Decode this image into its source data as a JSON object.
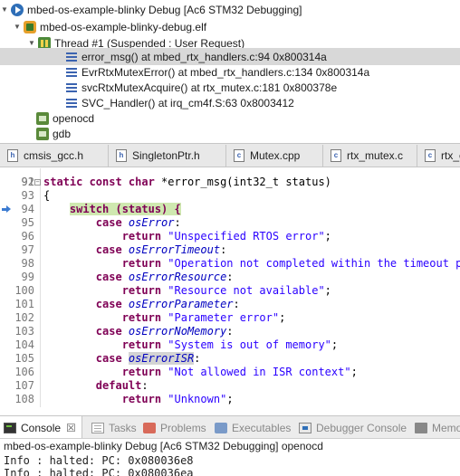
{
  "debug_tree": {
    "launch": "mbed-os-example-blinky Debug [Ac6 STM32 Debugging]",
    "elf": "mbed-os-example-blinky-debug.elf",
    "thread": "Thread #1 (Suspended : User Request)",
    "frames": [
      "error_msg() at mbed_rtx_handlers.c:94 0x800314a",
      "EvrRtxMutexError() at mbed_rtx_handlers.c:134 0x800314a",
      "svcRtxMutexAcquire() at rtx_mutex.c:181 0x800378e",
      "SVC_Handler() at irq_cm4f.S:63 0x8003412"
    ],
    "processes": [
      "openocd",
      "gdb"
    ]
  },
  "editor_tabs": [
    {
      "icon": "h",
      "label": "cmsis_gcc.h"
    },
    {
      "icon": "h",
      "label": "SingletonPtr.h"
    },
    {
      "icon": "c",
      "label": "Mutex.cpp"
    },
    {
      "icon": "c",
      "label": "rtx_mutex.c"
    },
    {
      "icon": "c",
      "label": "rtx_co"
    }
  ],
  "code": {
    "partial_line_number": "91",
    "lines": [
      {
        "n": "92",
        "parts": [
          [
            "kw",
            "static const char "
          ],
          [
            "",
            "*error_msg(int32_t status)"
          ]
        ]
      },
      {
        "n": "93",
        "parts": [
          [
            "",
            "{"
          ]
        ]
      },
      {
        "n": "94",
        "parts": [
          [
            "",
            "    "
          ],
          [
            "kw-green",
            "switch (status) {"
          ]
        ]
      },
      {
        "n": "95",
        "parts": [
          [
            "",
            "        "
          ],
          [
            "kw",
            "case "
          ],
          [
            "en",
            "osError"
          ],
          [
            "",
            ":"
          ]
        ]
      },
      {
        "n": "96",
        "parts": [
          [
            "",
            "            "
          ],
          [
            "kw",
            "return "
          ],
          [
            "str",
            "\"Unspecified RTOS error\""
          ],
          [
            "",
            ";"
          ]
        ]
      },
      {
        "n": "97",
        "parts": [
          [
            "",
            "        "
          ],
          [
            "kw",
            "case "
          ],
          [
            "en",
            "osErrorTimeout"
          ],
          [
            "",
            ":"
          ]
        ]
      },
      {
        "n": "98",
        "parts": [
          [
            "",
            "            "
          ],
          [
            "kw",
            "return "
          ],
          [
            "str",
            "\"Operation not completed within the timeout per"
          ]
        ]
      },
      {
        "n": "99",
        "parts": [
          [
            "",
            "        "
          ],
          [
            "kw",
            "case "
          ],
          [
            "en",
            "osErrorResource"
          ],
          [
            "",
            ":"
          ]
        ]
      },
      {
        "n": "100",
        "parts": [
          [
            "",
            "            "
          ],
          [
            "kw",
            "return "
          ],
          [
            "str",
            "\"Resource not available\""
          ],
          [
            "",
            ";"
          ]
        ]
      },
      {
        "n": "101",
        "parts": [
          [
            "",
            "        "
          ],
          [
            "kw",
            "case "
          ],
          [
            "en",
            "osErrorParameter"
          ],
          [
            "",
            ":"
          ]
        ]
      },
      {
        "n": "102",
        "parts": [
          [
            "",
            "            "
          ],
          [
            "kw",
            "return "
          ],
          [
            "str",
            "\"Parameter error\""
          ],
          [
            "",
            ";"
          ]
        ]
      },
      {
        "n": "103",
        "parts": [
          [
            "",
            "        "
          ],
          [
            "kw",
            "case "
          ],
          [
            "en",
            "osErrorNoMemory"
          ],
          [
            "",
            ":"
          ]
        ]
      },
      {
        "n": "104",
        "parts": [
          [
            "",
            "            "
          ],
          [
            "kw",
            "return "
          ],
          [
            "str",
            "\"System is out of memory\""
          ],
          [
            "",
            ";"
          ]
        ]
      },
      {
        "n": "105",
        "parts": [
          [
            "",
            "        "
          ],
          [
            "kw",
            "case "
          ],
          [
            "en-sel",
            "osErrorISR"
          ],
          [
            "",
            ":"
          ]
        ]
      },
      {
        "n": "106",
        "parts": [
          [
            "",
            "            "
          ],
          [
            "kw",
            "return "
          ],
          [
            "str",
            "\"Not allowed in ISR context\""
          ],
          [
            "",
            ";"
          ]
        ]
      },
      {
        "n": "107",
        "parts": [
          [
            "",
            "        "
          ],
          [
            "kw",
            "default"
          ],
          [
            "",
            ":"
          ]
        ]
      },
      {
        "n": "108",
        "parts": [
          [
            "",
            "            "
          ],
          [
            "kw",
            "return "
          ],
          [
            "str",
            "\"Unknown\""
          ],
          [
            "",
            ";"
          ]
        ]
      }
    ]
  },
  "console_tabs": [
    {
      "label": "Console",
      "close": "☒"
    },
    {
      "label": "Tasks"
    },
    {
      "label": "Problems"
    },
    {
      "label": "Executables"
    },
    {
      "label": "Debugger Console"
    },
    {
      "label": "Memo"
    }
  ],
  "console": {
    "header": "mbed-os-example-blinky Debug [Ac6 STM32 Debugging] openocd",
    "lines": [
      "Info : halted: PC: 0x080036e8",
      "Info : halted: PC: 0x080036ea"
    ]
  },
  "colors": {
    "keyword": "#7f0055",
    "string": "#2a00ff",
    "enum": "#0000c0",
    "current_line_highlight": "#cfe8b0",
    "selection": "#d8d8d8"
  },
  "icons": {
    "launch": "debug-launch-icon",
    "elf": "elf-binary-icon",
    "thread": "thread-suspended-icon",
    "frame": "stack-frame-icon",
    "process": "process-icon",
    "pc_arrow": "instruction-pointer-arrow-icon"
  }
}
